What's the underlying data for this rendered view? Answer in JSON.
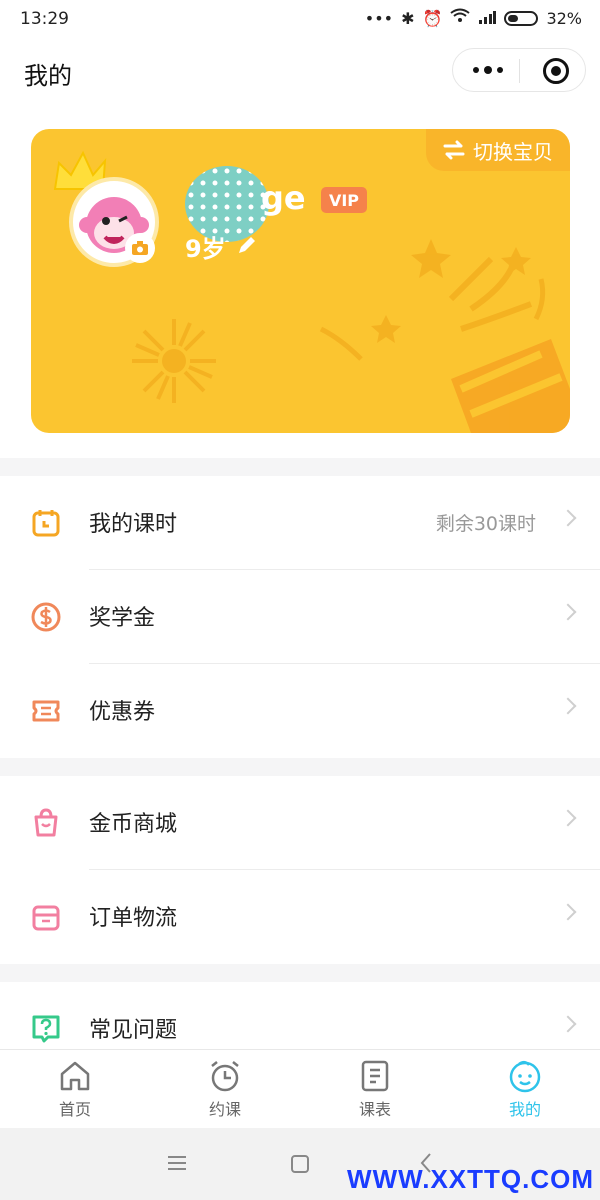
{
  "status_bar": {
    "time": "13:29",
    "battery": "32%"
  },
  "header": {
    "title": "我的"
  },
  "profile": {
    "switch_label": "切换宝贝",
    "name": "ge",
    "vip": "VIP",
    "age": "9岁"
  },
  "menu_group1": [
    {
      "label": "我的课时",
      "extra": "剩余30课时",
      "icon": "calendar-clock-icon",
      "color": "#f5a623"
    },
    {
      "label": "奖学金",
      "extra": "",
      "icon": "dollar-coin-icon",
      "color": "#f0885a"
    },
    {
      "label": "优惠券",
      "extra": "",
      "icon": "ticket-icon",
      "color": "#f0885a"
    }
  ],
  "menu_group2": [
    {
      "label": "金币商城",
      "icon": "shopping-bag-icon",
      "color": "#f27fa0"
    },
    {
      "label": "订单物流",
      "icon": "box-icon",
      "color": "#f27fa0"
    }
  ],
  "menu_group3": [
    {
      "label": "常见问题",
      "icon": "question-icon",
      "color": "#35c98a"
    }
  ],
  "tabbar": {
    "tabs": [
      {
        "label": "首页",
        "icon": "home-icon"
      },
      {
        "label": "约课",
        "icon": "alarm-clock-icon"
      },
      {
        "label": "课表",
        "icon": "notebook-icon"
      },
      {
        "label": "我的",
        "icon": "baby-face-icon",
        "active": true
      }
    ]
  },
  "watermark": "WWW.XXTTQ.COM",
  "colors": {
    "card": "#fbc530",
    "accent": "#2ec3ea",
    "vip": "#f5824b"
  }
}
